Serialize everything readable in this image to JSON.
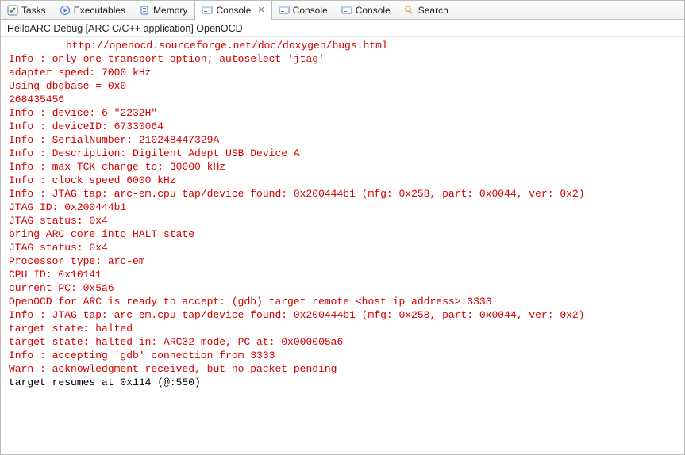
{
  "tabs": [
    {
      "label": "Tasks"
    },
    {
      "label": "Executables"
    },
    {
      "label": "Memory"
    },
    {
      "label": "Console",
      "active": true
    },
    {
      "label": "Console"
    },
    {
      "label": "Console"
    },
    {
      "label": "Search"
    }
  ],
  "subheader": "HelloARC Debug [ARC C/C++ application] OpenOCD",
  "console": {
    "lines": [
      {
        "cls": "red url-indent",
        "text": "http://openocd.sourceforge.net/doc/doxygen/bugs.html"
      },
      {
        "cls": "red",
        "text": "Info : only one transport option; autoselect 'jtag'"
      },
      {
        "cls": "red",
        "text": "adapter speed: 7000 kHz"
      },
      {
        "cls": "red",
        "text": "Using dbgbase = 0x0"
      },
      {
        "cls": "red",
        "text": "268435456"
      },
      {
        "cls": "red",
        "text": "Info : device: 6 \"2232H\""
      },
      {
        "cls": "red",
        "text": "Info : deviceID: 67330064"
      },
      {
        "cls": "red",
        "text": "Info : SerialNumber: 210248447329A"
      },
      {
        "cls": "red",
        "text": "Info : Description: Digilent Adept USB Device A"
      },
      {
        "cls": "red",
        "text": "Info : max TCK change to: 30000 kHz"
      },
      {
        "cls": "red",
        "text": "Info : clock speed 6000 kHz"
      },
      {
        "cls": "red",
        "text": "Info : JTAG tap: arc-em.cpu tap/device found: 0x200444b1 (mfg: 0x258, part: 0x0044, ver: 0x2)"
      },
      {
        "cls": "red",
        "text": "JTAG ID: 0x200444b1"
      },
      {
        "cls": "red",
        "text": "JTAG status: 0x4"
      },
      {
        "cls": "red",
        "text": "bring ARC core into HALT state"
      },
      {
        "cls": "red",
        "text": "JTAG status: 0x4"
      },
      {
        "cls": "red",
        "text": "Processor type: arc-em"
      },
      {
        "cls": "red",
        "text": "CPU ID: 0x10141"
      },
      {
        "cls": "red",
        "text": "current PC: 0x5a6"
      },
      {
        "cls": "red",
        "text": "OpenOCD for ARC is ready to accept: (gdb) target remote <host ip address>:3333"
      },
      {
        "cls": "red",
        "text": "Info : JTAG tap: arc-em.cpu tap/device found: 0x200444b1 (mfg: 0x258, part: 0x0044, ver: 0x2)"
      },
      {
        "cls": "red",
        "text": "target state: halted"
      },
      {
        "cls": "red",
        "text": "target state: halted in: ARC32 mode, PC at: 0x000005a6"
      },
      {
        "cls": "red",
        "text": "Info : accepting 'gdb' connection from 3333"
      },
      {
        "cls": "red",
        "text": "Warn : acknowledgment received, but no packet pending"
      },
      {
        "cls": "black",
        "text": "target resumes at 0x114 (@:550)"
      }
    ]
  }
}
